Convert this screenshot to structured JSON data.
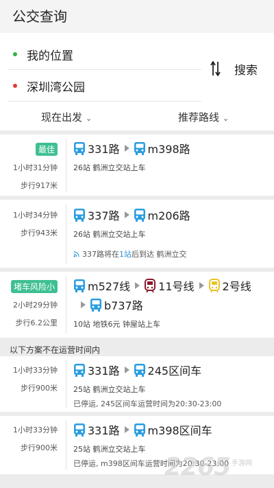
{
  "header": {
    "title": "公交查询"
  },
  "search": {
    "from": "我的位置",
    "to": "深圳湾公园",
    "search_label": "搜索",
    "depart_filter": "现在出发",
    "sort_filter": "推荐路线"
  },
  "colors": {
    "from_dot": "#2fb24a",
    "to_dot": "#e53935",
    "bus": "#2a9de0",
    "metro_11": "#8b1a2b",
    "metro_2": "#e8c22a",
    "badge": "#3fc092"
  },
  "icons": {
    "bus": "bus-icon",
    "metro": "metro-icon",
    "swap": "swap-icon",
    "chevron": "chevron-down-icon",
    "realtime": "realtime-signal-icon"
  },
  "routes": [
    {
      "badge": "最佳",
      "duration": "1小时31分钟",
      "walk": "步行917米",
      "segments": [
        "331路",
        "m398路"
      ],
      "detail": "26站  鹤洲立交站上车"
    },
    {
      "duration": "1小时34分钟",
      "walk": "步行943米",
      "segments": [
        "337路",
        "m206路"
      ],
      "detail": "26站  鹤洲立交站上车",
      "realtime_pre": "337路将在",
      "realtime_hl": "1站",
      "realtime_post": "后到达 鹤洲立交"
    },
    {
      "badge": "堵车风险小",
      "duration": "2小时29分钟",
      "walk": "步行6.2公里",
      "segments": [
        "m527线",
        "11号线",
        "2号线",
        "b737路"
      ],
      "detail": "10站 地铁6元 钟屋站上车"
    }
  ],
  "notice": "以下方案不在运营时间内",
  "closed_routes": [
    {
      "duration": "1小时33分钟",
      "walk": "步行900米",
      "segments": [
        "331路",
        "245区间车"
      ],
      "detail": "25站  鹤洲立交站上车",
      "status": "已停运, 245区间车运营时间为20:30-23:00"
    },
    {
      "duration": "1小时33分钟",
      "walk": "步行900米",
      "segments": [
        "331路",
        "m398区间车"
      ],
      "detail": "25站  鹤洲立交站上车",
      "status": "已停运, m398区间车运营时间为20:30-23:00"
    }
  ],
  "watermark": {
    "main": "2265",
    "sub": "手游网"
  }
}
